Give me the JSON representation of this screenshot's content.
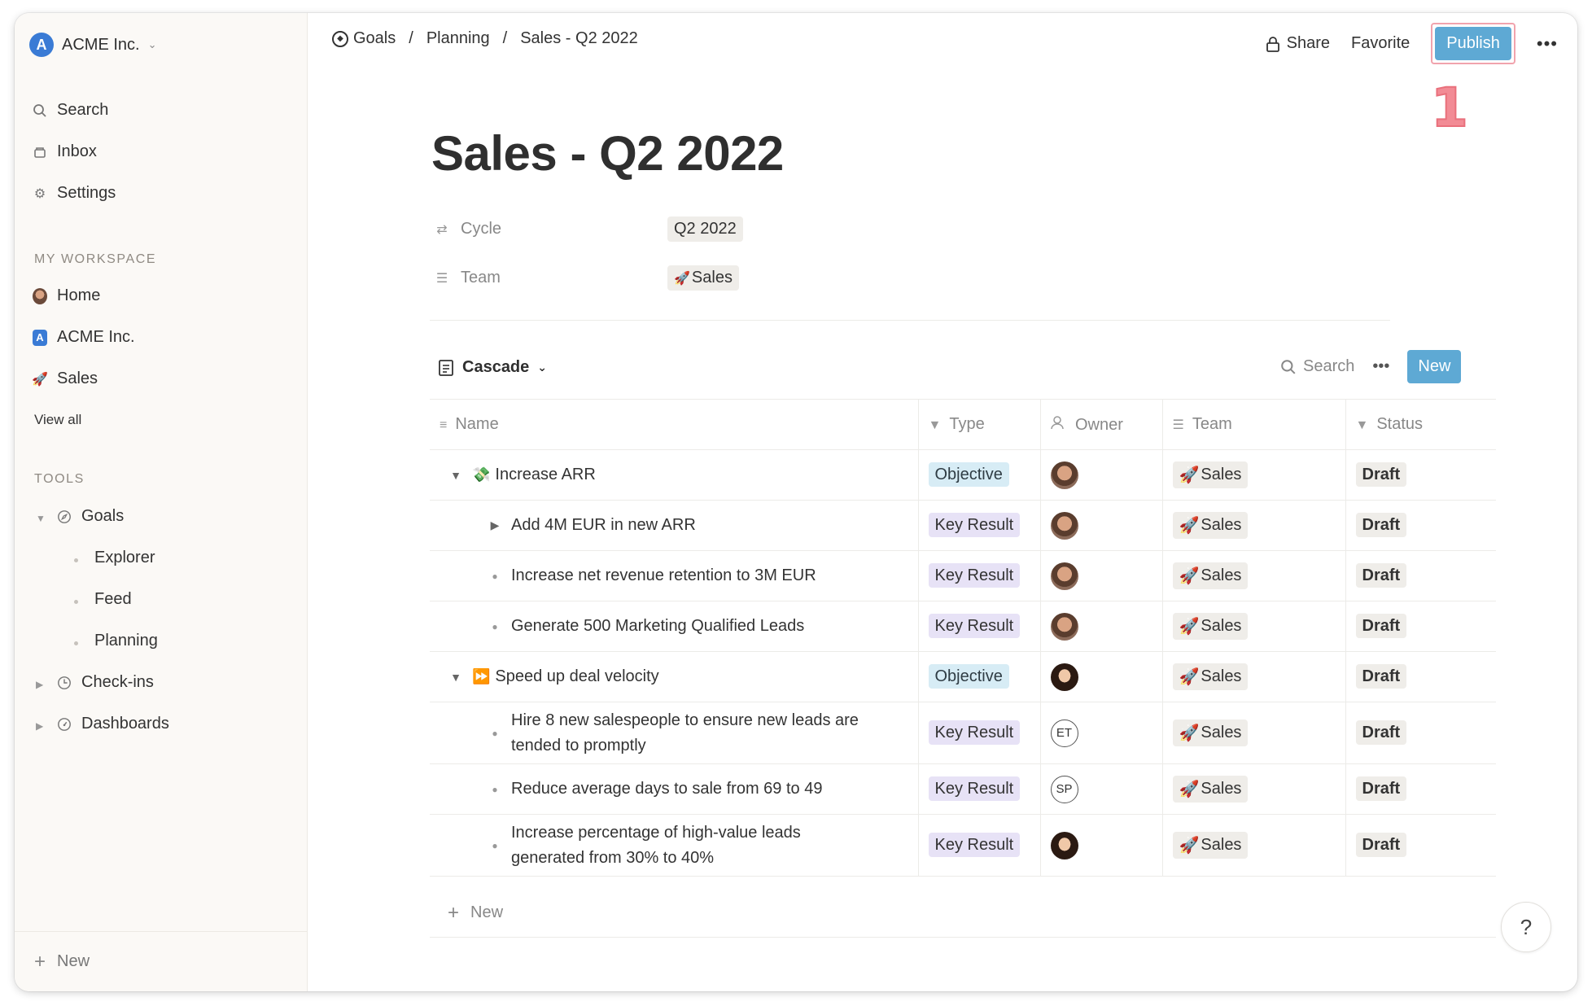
{
  "workspace": {
    "name": "ACME Inc.",
    "logo_letter": "A"
  },
  "sidebar": {
    "primary": [
      {
        "label": "Search",
        "icon": "search-icon"
      },
      {
        "label": "Inbox",
        "icon": "inbox-icon"
      },
      {
        "label": "Settings",
        "icon": "gear-icon"
      }
    ],
    "my_workspace_label": "MY WORKSPACE",
    "workspace_items": [
      {
        "label": "Home",
        "icon": "avatar"
      },
      {
        "label": "ACME Inc.",
        "icon": "acme-logo"
      },
      {
        "label": "Sales",
        "icon": "rocket-icon"
      }
    ],
    "view_all": "View all",
    "tools_label": "TOOLS",
    "tools": {
      "goals": {
        "label": "Goals",
        "children": [
          "Explorer",
          "Feed",
          "Planning"
        ]
      },
      "checkins": {
        "label": "Check-ins"
      },
      "dashboards": {
        "label": "Dashboards"
      }
    },
    "footer_new": "New"
  },
  "breadcrumb": [
    "Goals",
    "Planning",
    "Sales - Q2 2022"
  ],
  "top_actions": {
    "share": "Share",
    "favorite": "Favorite",
    "publish": "Publish",
    "more": "•••"
  },
  "annotation": "1",
  "page": {
    "title": "Sales - Q2 2022",
    "properties": [
      {
        "label": "Cycle",
        "value": "Q2 2022"
      },
      {
        "label": "Team",
        "value": "Sales"
      }
    ]
  },
  "view": {
    "name": "Cascade",
    "search": "Search",
    "more": "•••",
    "new": "New"
  },
  "columns": [
    "Name",
    "Type",
    "Owner",
    "Team",
    "Status"
  ],
  "rows": [
    {
      "name": "Increase ARR",
      "type": "Objective",
      "owner": "",
      "team": "Sales",
      "status": "Draft"
    },
    {
      "name": "Add 4M EUR in new ARR",
      "type": "Key Result",
      "owner": "",
      "team": "Sales",
      "status": "Draft"
    },
    {
      "name": "Increase net revenue retention to 3M EUR",
      "type": "Key Result",
      "owner": "",
      "team": "Sales",
      "status": "Draft"
    },
    {
      "name": "Generate 500 Marketing Qualified Leads",
      "type": "Key Result",
      "owner": "",
      "team": "Sales",
      "status": "Draft"
    },
    {
      "name": "Speed up deal velocity",
      "type": "Objective",
      "owner": "",
      "team": "Sales",
      "status": "Draft"
    },
    {
      "name": "Hire 8 new salespeople to ensure new leads are tended to promptly",
      "type": "Key Result",
      "owner": "ET",
      "team": "Sales",
      "status": "Draft"
    },
    {
      "name": "Reduce average days to sale from 69 to 49",
      "type": "Key Result",
      "owner": "SP",
      "team": "Sales",
      "status": "Draft"
    },
    {
      "name": "Increase percentage of high-value leads generated from 30% to 40%",
      "type": "Key Result",
      "owner": "",
      "team": "Sales",
      "status": "Draft"
    }
  ],
  "add_row": "New",
  "help": "?",
  "colors": {
    "accent": "#5ea9d4",
    "sidebar_bg": "#fbf9f6",
    "objective_bg": "#d7ecf5",
    "key_result_bg": "#e7e2f6",
    "chip_bg": "#efede9"
  }
}
